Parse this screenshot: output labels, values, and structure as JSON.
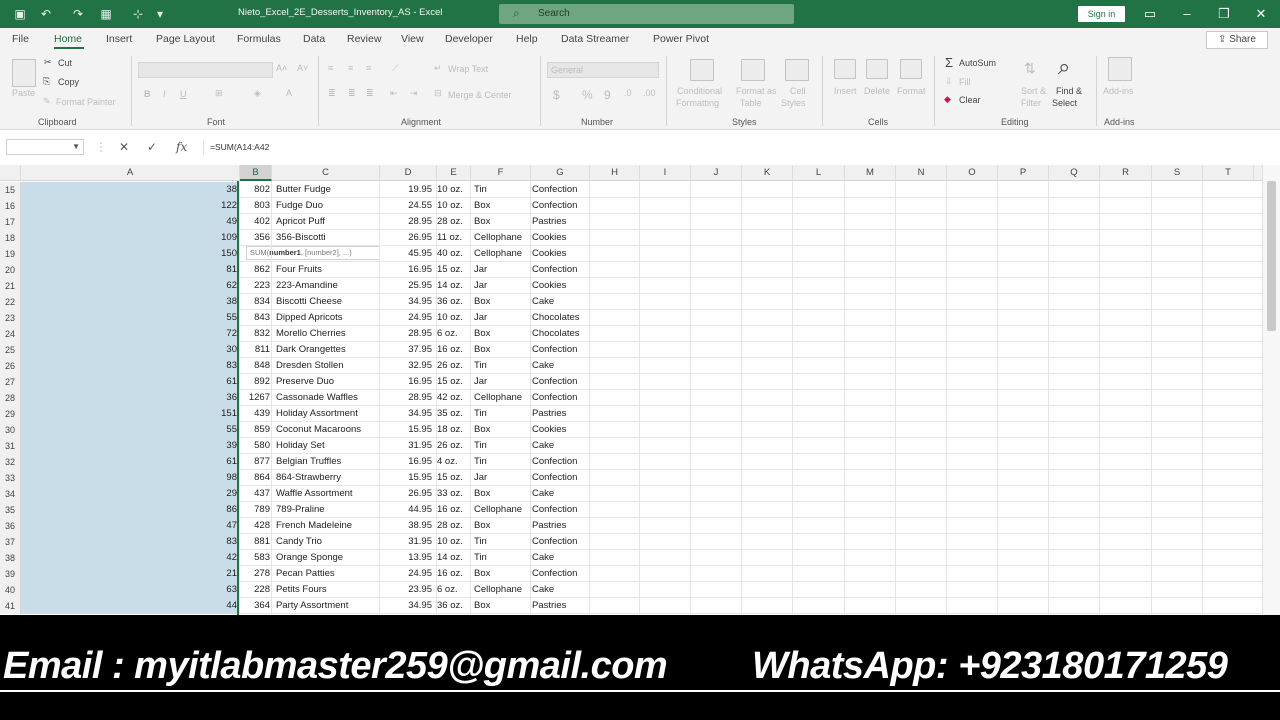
{
  "titlebar": {
    "document_title": "Nieto_Excel_2E_Desserts_Inventory_AS  -  Excel",
    "search_placeholder": "Search",
    "sign_in": "Sign in"
  },
  "menu": {
    "tabs": [
      "File",
      "Home",
      "Insert",
      "Page Layout",
      "Formulas",
      "Data",
      "Review",
      "View",
      "Developer",
      "Help",
      "Data Streamer",
      "Power Pivot"
    ],
    "active": "Home",
    "share": "Share"
  },
  "ribbon": {
    "clipboard": {
      "paste": "Paste",
      "cut": "Cut",
      "copy": "Copy",
      "format_painter": "Format Painter",
      "label": "Clipboard"
    },
    "font": {
      "label": "Font"
    },
    "alignment": {
      "wrap_text": "Wrap Text",
      "merge_center": "Merge & Center",
      "label": "Alignment"
    },
    "number": {
      "format": "General",
      "label": "Number"
    },
    "styles": {
      "conditional": "Conditional",
      "formatting": "Formatting",
      "format_as": "Format as",
      "table": "Table",
      "cell": "Cell",
      "styles": "Styles",
      "label": "Styles"
    },
    "cells": {
      "insert": "Insert",
      "delete": "Delete",
      "format": "Format",
      "label": "Cells"
    },
    "editing": {
      "autosum": "AutoSum",
      "fill": "Fill",
      "clear": "Clear",
      "sort_filter": "Sort &",
      "filter": "Filter",
      "find_select": "Find &",
      "select": "Select",
      "label": "Editing"
    },
    "addins": {
      "addins": "Add-ins",
      "label": "Add-ins"
    }
  },
  "formula_bar": {
    "name_box": "",
    "formula": "=SUM(A14:A42"
  },
  "grid": {
    "columns": [
      "A",
      "B",
      "C",
      "D",
      "E",
      "F",
      "G",
      "H",
      "I",
      "J",
      "K",
      "L",
      "M",
      "N",
      "O",
      "P",
      "Q",
      "R",
      "S",
      "T"
    ],
    "selected_column": "B",
    "tooltip_fn": "SUM(",
    "tooltip_bold": "number1",
    "tooltip_rest": ", [number2], ...)",
    "rows": [
      {
        "n": "15",
        "a": "38",
        "b": "802",
        "c": "Butter Fudge",
        "d": "19.95",
        "e": "10 oz.",
        "f": "Tin",
        "g": "Confection"
      },
      {
        "n": "16",
        "a": "122",
        "b": "803",
        "c": "Fudge Duo",
        "d": "24.55",
        "e": "10 oz.",
        "f": "Box",
        "g": "Confection"
      },
      {
        "n": "17",
        "a": "49",
        "b": "402",
        "c": "Apricot Puff",
        "d": "28.95",
        "e": "28 oz.",
        "f": "Box",
        "g": "Pastries"
      },
      {
        "n": "18",
        "a": "109",
        "b": "356",
        "c": "356-Biscotti",
        "d": "26.95",
        "e": "11 oz.",
        "f": "Cellophane",
        "g": "Cookies"
      },
      {
        "n": "19",
        "a": "150",
        "b": "",
        "c": "",
        "d": "45.95",
        "e": "40 oz.",
        "f": "Cellophane",
        "g": "Cookies"
      },
      {
        "n": "20",
        "a": "81",
        "b": "862",
        "c": "Four Fruits",
        "d": "16.95",
        "e": "15 oz.",
        "f": "Jar",
        "g": "Confection"
      },
      {
        "n": "21",
        "a": "62",
        "b": "223",
        "c": "223-Amandine",
        "d": "25.95",
        "e": "14 oz.",
        "f": "Jar",
        "g": "Cookies"
      },
      {
        "n": "22",
        "a": "38",
        "b": "834",
        "c": "Biscotti Cheese",
        "d": "34.95",
        "e": "36 oz.",
        "f": "Box",
        "g": "Cake"
      },
      {
        "n": "23",
        "a": "55",
        "b": "843",
        "c": "Dipped Apricots",
        "d": "24.95",
        "e": "10 oz.",
        "f": "Jar",
        "g": "Chocolates"
      },
      {
        "n": "24",
        "a": "72",
        "b": "832",
        "c": "Morello Cherries",
        "d": "28.95",
        "e": "6 oz.",
        "f": "Box",
        "g": "Chocolates"
      },
      {
        "n": "25",
        "a": "30",
        "b": "811",
        "c": "Dark Orangettes",
        "d": "37.95",
        "e": "16 oz.",
        "f": "Box",
        "g": "Confection"
      },
      {
        "n": "26",
        "a": "83",
        "b": "848",
        "c": "Dresden Stollen",
        "d": "32.95",
        "e": "26 oz.",
        "f": "Tin",
        "g": "Cake"
      },
      {
        "n": "27",
        "a": "61",
        "b": "892",
        "c": "Preserve Duo",
        "d": "16.95",
        "e": "15 oz.",
        "f": "Jar",
        "g": "Confection"
      },
      {
        "n": "28",
        "a": "36",
        "b": "1267",
        "c": "Cassonade Waffles",
        "d": "28.95",
        "e": "42 oz.",
        "f": "Cellophane",
        "g": "Confection"
      },
      {
        "n": "29",
        "a": "151",
        "b": "439",
        "c": "Holiday Assortment",
        "d": "34.95",
        "e": "35 oz.",
        "f": "Tin",
        "g": "Pastries"
      },
      {
        "n": "30",
        "a": "55",
        "b": "859",
        "c": "Coconut Macaroons",
        "d": "15.95",
        "e": "18 oz.",
        "f": "Box",
        "g": "Cookies"
      },
      {
        "n": "31",
        "a": "39",
        "b": "580",
        "c": "Holiday Set",
        "d": "31.95",
        "e": "26 oz.",
        "f": "Tin",
        "g": "Cake"
      },
      {
        "n": "32",
        "a": "61",
        "b": "877",
        "c": "Belgian Truffles",
        "d": "16.95",
        "e": "4 oz.",
        "f": "Tin",
        "g": "Confection"
      },
      {
        "n": "33",
        "a": "98",
        "b": "864",
        "c": "864-Strawberry",
        "d": "15.95",
        "e": "15 oz.",
        "f": "Jar",
        "g": "Confection"
      },
      {
        "n": "34",
        "a": "29",
        "b": "437",
        "c": "Waffle Assortment",
        "d": "26.95",
        "e": "33 oz.",
        "f": "Box",
        "g": "Cake"
      },
      {
        "n": "35",
        "a": "86",
        "b": "789",
        "c": "789-Praline",
        "d": "44.95",
        "e": "16 oz.",
        "f": "Cellophane",
        "g": "Confection"
      },
      {
        "n": "36",
        "a": "47",
        "b": "428",
        "c": "French Madeleine",
        "d": "38.95",
        "e": "28 oz.",
        "f": "Box",
        "g": "Pastries"
      },
      {
        "n": "37",
        "a": "83",
        "b": "881",
        "c": "Candy Trio",
        "d": "31.95",
        "e": "10 oz.",
        "f": "Tin",
        "g": "Confection"
      },
      {
        "n": "38",
        "a": "42",
        "b": "583",
        "c": "Orange Sponge",
        "d": "13.95",
        "e": "14 oz.",
        "f": "Tin",
        "g": "Cake"
      },
      {
        "n": "39",
        "a": "21",
        "b": "278",
        "c": "Pecan Patties",
        "d": "24.95",
        "e": "16 oz.",
        "f": "Box",
        "g": "Confection"
      },
      {
        "n": "40",
        "a": "63",
        "b": "228",
        "c": "Petits Fours",
        "d": "23.95",
        "e": "6 oz.",
        "f": "Cellophane",
        "g": "Cake"
      },
      {
        "n": "41",
        "a": "44",
        "b": "364",
        "c": "Party Assortment",
        "d": "34.95",
        "e": "36 oz.",
        "f": "Box",
        "g": "Pastries"
      }
    ]
  },
  "banner": {
    "email": "Email : myitlabmaster259@gmail.com",
    "whatsapp": "WhatsApp: +923180171259"
  },
  "colors": {
    "excel_green": "#217346",
    "selection_fill": "#c9dde9",
    "banner_bg": "#000000"
  }
}
